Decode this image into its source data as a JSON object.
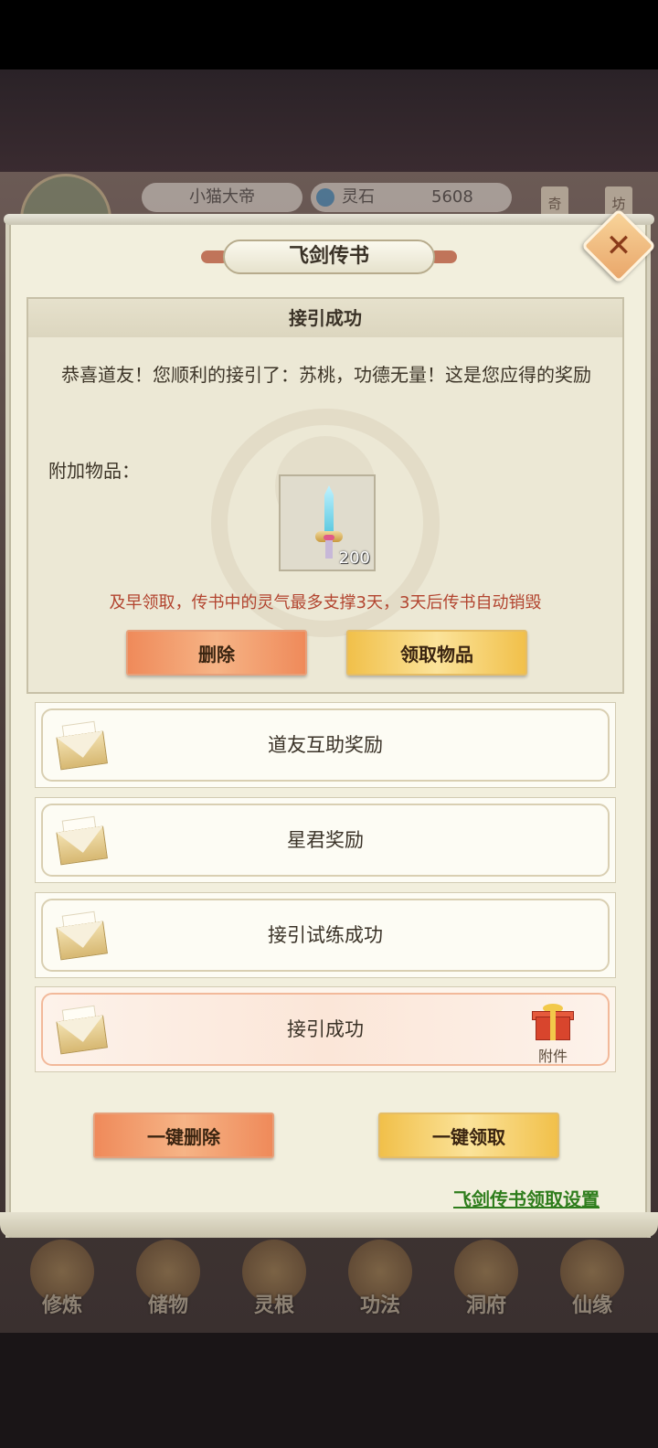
{
  "hud": {
    "player_name": "小猫大帝",
    "currency_label": "灵石",
    "currency_value": "5608",
    "side_tag_left": "奇",
    "side_tag_right": "坊"
  },
  "dialog": {
    "title": "飞剑传书",
    "close_symbol": "✕",
    "detail": {
      "header": "接引成功",
      "message": "恭喜道友！您顺利的接引了：苏桃，功德无量！这是您应得的奖励",
      "attach_label": "附加物品：",
      "item_qty": "200",
      "warning": "及早领取，传书中的灵气最多支撑3天，3天后传书自动销毁",
      "delete_label": "删除",
      "claim_label": "领取物品"
    },
    "mails": [
      {
        "title": "道友互助奖励"
      },
      {
        "title": "星君奖励"
      },
      {
        "title": "接引试练成功"
      },
      {
        "title": "接引成功",
        "attachment_label": "附件"
      }
    ],
    "delete_all_label": "一键删除",
    "claim_all_label": "一键领取",
    "settings_link": "飞剑传书领取设置"
  },
  "bottom_nav": [
    "修炼",
    "储物",
    "灵根",
    "功法",
    "洞府",
    "仙缘"
  ],
  "colors": {
    "warning_text": "#b2442f",
    "link_green": "#2e7d1c",
    "button_orange": "#ef8a5a",
    "button_gold": "#f1c04a"
  }
}
